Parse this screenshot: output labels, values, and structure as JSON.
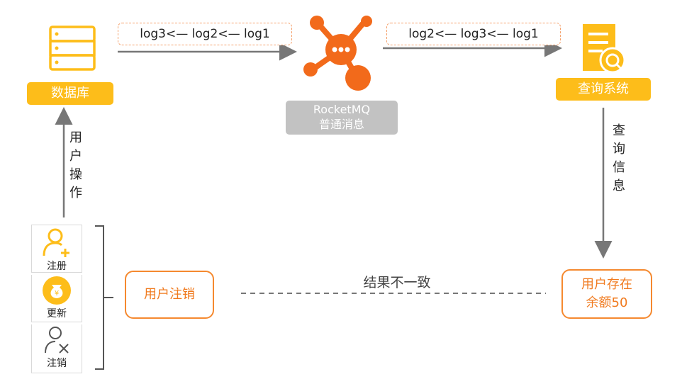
{
  "database": {
    "label": "数据库"
  },
  "mq": {
    "line1": "RocketMQ",
    "line2": "普通消息"
  },
  "query": {
    "label": "查询系统"
  },
  "log_left": "log3<— log2<— log1",
  "log_right": "log2<— log3<— log1",
  "user_op": "用户操作",
  "query_info": "查询信息",
  "actions": [
    {
      "label": "注册",
      "icon": "user-add-icon"
    },
    {
      "label": "更新",
      "icon": "money-bag-icon"
    },
    {
      "label": "注销",
      "icon": "user-remove-icon"
    }
  ],
  "user_cancel": "用户注销",
  "user_exists": {
    "line1": "用户存在",
    "line2": "余额50"
  },
  "inconsistent": "结果不一致",
  "colors": {
    "yellow": "#fdbd1a",
    "orange": "#f5892f",
    "mq_orange": "#f26a1b",
    "grey": "#c2c2c2",
    "arrow": "#777777"
  }
}
